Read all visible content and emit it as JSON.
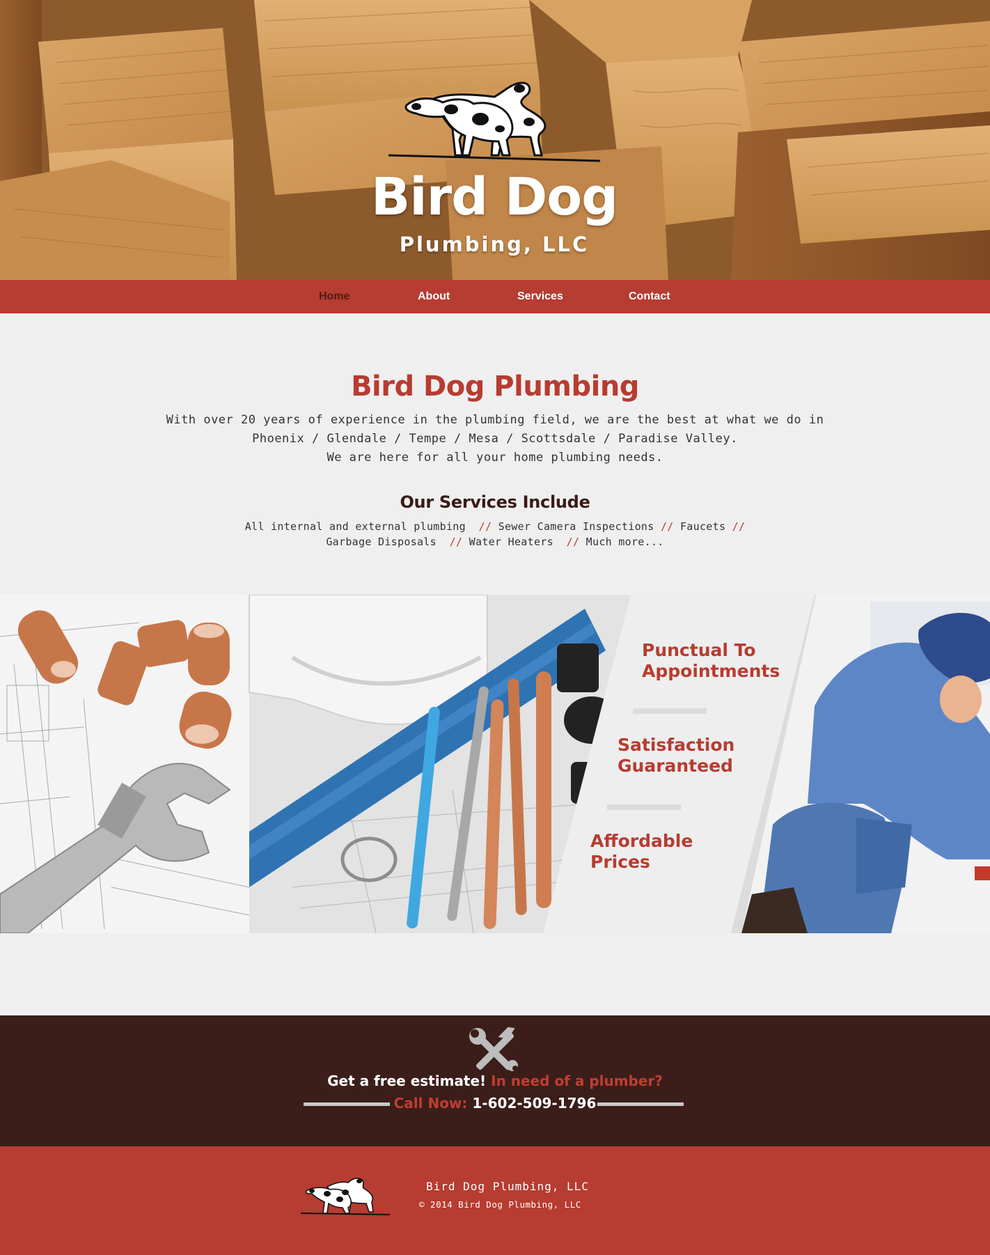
{
  "hero": {
    "brand_title": "Bird Dog",
    "brand_subtitle": "Plumbing, LLC",
    "logo_icon": "bird-dogs-logo"
  },
  "nav": {
    "items": [
      {
        "label": "Home",
        "active": true
      },
      {
        "label": "About",
        "active": false
      },
      {
        "label": "Services",
        "active": false
      },
      {
        "label": "Contact",
        "active": false
      }
    ]
  },
  "intro": {
    "heading": "Bird Dog Plumbing",
    "line1": "With over 20 years of experience in the plumbing field, we are the best at what we do in",
    "line2": "Phoenix / Glendale / Tempe / Mesa / Scottsdale / Paradise Valley.",
    "line3": "We are here for all your home plumbing needs.",
    "services_heading": "Our Services Include",
    "services": [
      "All internal and external plumbing",
      "Sewer Camera Inspections",
      "Faucets",
      "Garbage Disposals",
      "Water Heaters",
      "Much more..."
    ],
    "separator": "//"
  },
  "features": {
    "f1_line1": "Punctual To",
    "f1_line2": "Appointments",
    "f2_line1": "Satisfaction",
    "f2_line2": "Guaranteed",
    "f3_line1": "Affordable",
    "f3_line2": "Prices"
  },
  "cta": {
    "icon": "wrench-hammer-icon",
    "free_estimate": "Get a free estimate!",
    "need_plumber": "In need of a plumber?",
    "call_now": "Call Now:",
    "phone": "1-602-509-1796"
  },
  "footer": {
    "company": "Bird Dog Plumbing, LLC",
    "copyright": "© 2014 Bird Dog Plumbing, LLC"
  },
  "colors": {
    "brand_red": "#b73c31",
    "dark_brown": "#3b1e19",
    "background": "#efefef"
  }
}
